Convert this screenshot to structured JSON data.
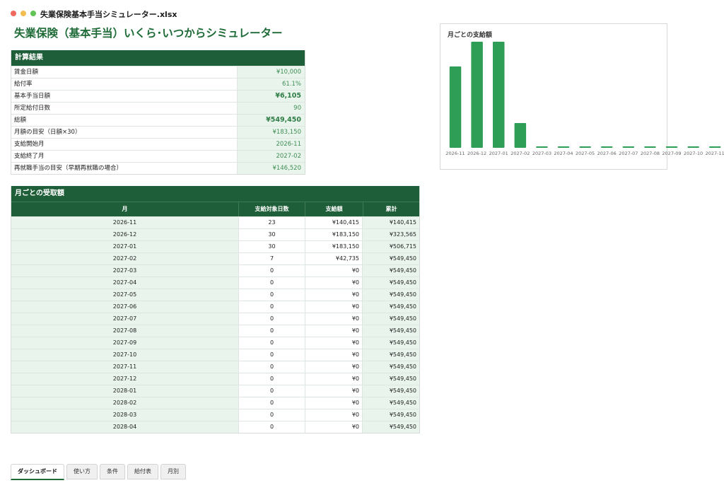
{
  "window": {
    "title": "失業保険基本手当シミュレーター.xlsx"
  },
  "page": {
    "heading": "失業保険（基本手当）いくら･いつからシミュレーター"
  },
  "summary": {
    "header": "計算結果",
    "rows": [
      {
        "label": "賃金日額",
        "value": "¥10,000"
      },
      {
        "label": "給付率",
        "value": "61.1%"
      },
      {
        "label": "基本手当日額",
        "value": "¥6,105"
      },
      {
        "label": "所定給付日数",
        "value": "90"
      },
      {
        "label": "総額",
        "value": "¥549,450"
      },
      {
        "label": "月額の目安（日額×30）",
        "value": "¥183,150"
      },
      {
        "label": "支給開始月",
        "value": "2026-11"
      },
      {
        "label": "支給終了月",
        "value": "2027-02"
      },
      {
        "label": "再就職手当の目安（早期再就職の場合）",
        "value": "¥146,520"
      }
    ]
  },
  "monthly": {
    "header": "月ごとの受取額",
    "columns": [
      "月",
      "支給対象日数",
      "支給額",
      "累計"
    ],
    "rows": [
      [
        "2026-11",
        "23",
        "¥140,415",
        "¥140,415"
      ],
      [
        "2026-12",
        "30",
        "¥183,150",
        "¥323,565"
      ],
      [
        "2027-01",
        "30",
        "¥183,150",
        "¥506,715"
      ],
      [
        "2027-02",
        "7",
        "¥42,735",
        "¥549,450"
      ],
      [
        "2027-03",
        "0",
        "¥0",
        "¥549,450"
      ],
      [
        "2027-04",
        "0",
        "¥0",
        "¥549,450"
      ],
      [
        "2027-05",
        "0",
        "¥0",
        "¥549,450"
      ],
      [
        "2027-06",
        "0",
        "¥0",
        "¥549,450"
      ],
      [
        "2027-07",
        "0",
        "¥0",
        "¥549,450"
      ],
      [
        "2027-08",
        "0",
        "¥0",
        "¥549,450"
      ],
      [
        "2027-09",
        "0",
        "¥0",
        "¥549,450"
      ],
      [
        "2027-10",
        "0",
        "¥0",
        "¥549,450"
      ],
      [
        "2027-11",
        "0",
        "¥0",
        "¥549,450"
      ],
      [
        "2027-12",
        "0",
        "¥0",
        "¥549,450"
      ],
      [
        "2028-01",
        "0",
        "¥0",
        "¥549,450"
      ],
      [
        "2028-02",
        "0",
        "¥0",
        "¥549,450"
      ],
      [
        "2028-03",
        "0",
        "¥0",
        "¥549,450"
      ],
      [
        "2028-04",
        "0",
        "¥0",
        "¥549,450"
      ]
    ]
  },
  "chart_data": {
    "type": "bar",
    "title": "月ごとの支給額",
    "categories": [
      "2026-11",
      "2026-12",
      "2027-01",
      "2027-02",
      "2027-03",
      "2027-04",
      "2027-05",
      "2027-06",
      "2027-07",
      "2027-08",
      "2027-09",
      "2027-10",
      "2027-11"
    ],
    "values": [
      140415,
      183150,
      183150,
      42735,
      0,
      0,
      0,
      0,
      0,
      0,
      0,
      0,
      0
    ],
    "color": "#2e9e57",
    "grid": false,
    "legend": "none"
  },
  "tabs": [
    "ダッシュボード",
    "使い方",
    "条件",
    "給付表",
    "月別"
  ],
  "colors": {
    "header": "#1e5e38",
    "accent": "#1e6b38",
    "cell": "#e9f4ec",
    "bar": "#2e9e57"
  }
}
